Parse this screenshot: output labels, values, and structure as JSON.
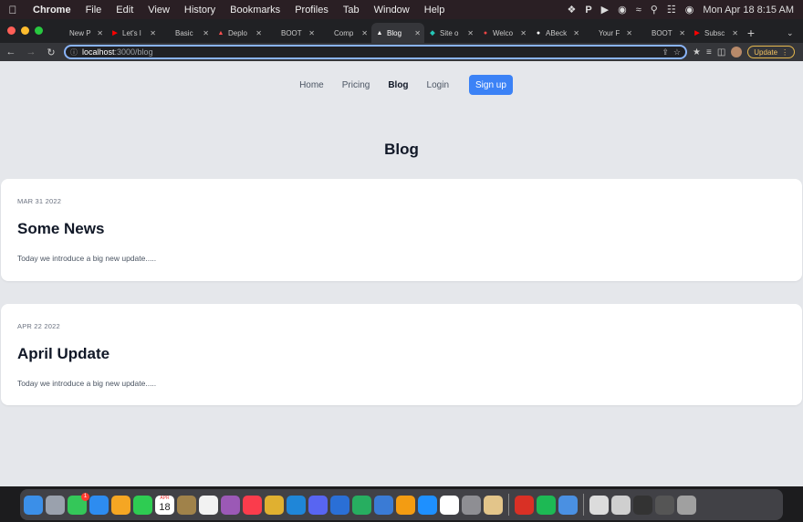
{
  "menubar": {
    "app": "Chrome",
    "items": [
      "File",
      "Edit",
      "View",
      "History",
      "Bookmarks",
      "Profiles",
      "Tab",
      "Window",
      "Help"
    ],
    "clock": "Mon Apr 18  8:15 AM"
  },
  "tabs": [
    {
      "label": "New P",
      "favicon": "DEV",
      "color": "#000000"
    },
    {
      "label": "Let's l",
      "favicon": "youtube",
      "color": "#ff0000"
    },
    {
      "label": "Basic",
      "favicon": "(A)",
      "color": "#333333"
    },
    {
      "label": "Deplo",
      "favicon": "vercel",
      "color": "#ff5050"
    },
    {
      "label": "BOOT",
      "favicon": "B",
      "color": "#2563eb"
    },
    {
      "label": "Comp",
      "favicon": "C",
      "color": "#7c3aed"
    },
    {
      "label": "Blog",
      "favicon": "triangle",
      "color": "#ffffff",
      "active": true
    },
    {
      "label": "Site o",
      "favicon": "netlify",
      "color": "#25c7b7"
    },
    {
      "label": "Welco",
      "favicon": "dot",
      "color": "#ef4444"
    },
    {
      "label": "ABeck",
      "favicon": "github",
      "color": "#ffffff"
    },
    {
      "label": "Your F",
      "favicon": "M",
      "color": "#ea4335"
    },
    {
      "label": "BOOT",
      "favicon": "B",
      "color": "#2563eb"
    },
    {
      "label": "Subsc",
      "favicon": "youtube",
      "color": "#ff0000"
    }
  ],
  "toolbar": {
    "url_host": "localhost",
    "url_path": ":3000/blog",
    "update_label": "Update"
  },
  "site": {
    "nav": {
      "home": "Home",
      "pricing": "Pricing",
      "blog": "Blog",
      "login": "Login",
      "signup": "Sign up"
    },
    "page_title": "Blog",
    "posts": [
      {
        "date": "MAR 31 2022",
        "title": "Some News",
        "excerpt": "Today we introduce a big new update....."
      },
      {
        "date": "APR 22 2022",
        "title": "April Update",
        "excerpt": "Today we introduce a big new update....."
      }
    ]
  },
  "colors": {
    "accent": "#3b82f6",
    "page_bg": "#e5e7eb",
    "card_bg": "#ffffff",
    "heading": "#111827"
  },
  "dock": {
    "apps": [
      {
        "name": "finder-icon",
        "color": "#3b8fe8"
      },
      {
        "name": "launchpad-icon",
        "color": "#9aa1ad"
      },
      {
        "name": "messages-icon",
        "color": "#34c759",
        "badge": "1"
      },
      {
        "name": "safari-icon",
        "color": "#2d8cf0"
      },
      {
        "name": "photos-icon",
        "color": "#f5a623"
      },
      {
        "name": "facetime-icon",
        "color": "#2ecc52"
      },
      {
        "name": "calendar-icon",
        "color": "#ffffff",
        "month": "APR",
        "day": "18"
      },
      {
        "name": "notes-app-icon",
        "color": "#a0824a"
      },
      {
        "name": "reminders-icon",
        "color": "#f2f2f2"
      },
      {
        "name": "quill-icon",
        "color": "#9b59b6"
      },
      {
        "name": "music-icon",
        "color": "#fa3c4c"
      },
      {
        "name": "chrome-icon",
        "color": "#e0b030"
      },
      {
        "name": "vscode-icon",
        "color": "#1f86d8"
      },
      {
        "name": "discord-icon",
        "color": "#5865f2"
      },
      {
        "name": "keynote-icon",
        "color": "#2a6fd6"
      },
      {
        "name": "numbers-icon",
        "color": "#27ae60"
      },
      {
        "name": "xcode-icon",
        "color": "#3a7bd5"
      },
      {
        "name": "pages-icon",
        "color": "#f39c12"
      },
      {
        "name": "app-store-icon",
        "color": "#1e90ff"
      },
      {
        "name": "slack-icon",
        "color": "#ffffff"
      },
      {
        "name": "system-preferences-icon",
        "color": "#8e8e93"
      },
      {
        "name": "sequel-icon",
        "color": "#e3c58a"
      },
      {
        "name": "pdf-reader-icon",
        "color": "#d93025"
      },
      {
        "name": "spotify-icon",
        "color": "#1db954"
      },
      {
        "name": "preview-icon",
        "color": "#4a90e2"
      },
      {
        "name": "document-thumbnail-icon",
        "color": "#dcdcdc"
      },
      {
        "name": "screenshot-thumbnail-icon",
        "color": "#cfcfcf"
      },
      {
        "name": "terminal-thumbnail-icon",
        "color": "#333333"
      },
      {
        "name": "window-thumbnail-icon",
        "color": "#555555"
      },
      {
        "name": "trash-icon",
        "color": "#a0a0a0"
      }
    ]
  }
}
